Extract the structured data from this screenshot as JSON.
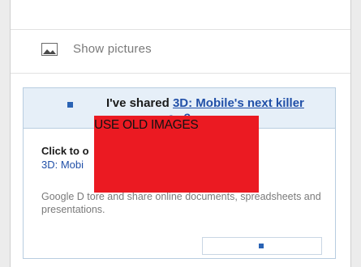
{
  "show_pictures": {
    "label": "Show pictures",
    "icon": "image-icon"
  },
  "share_card": {
    "header_prefix": "I've shared ",
    "header_link": "3D: Mobile's next killer",
    "header_line2": "a...?",
    "click_prefix": "Click to o",
    "click_link": "3D: Mobi",
    "description": "Google D                        tore and share online documents, spreadsheets and presentations."
  },
  "overlay": {
    "label": "USE OLD IMAGES",
    "color": "#eb1a22"
  },
  "colors": {
    "link": "#2150a8",
    "header_bg": "#e6eff8",
    "border": "#b8cde0"
  }
}
